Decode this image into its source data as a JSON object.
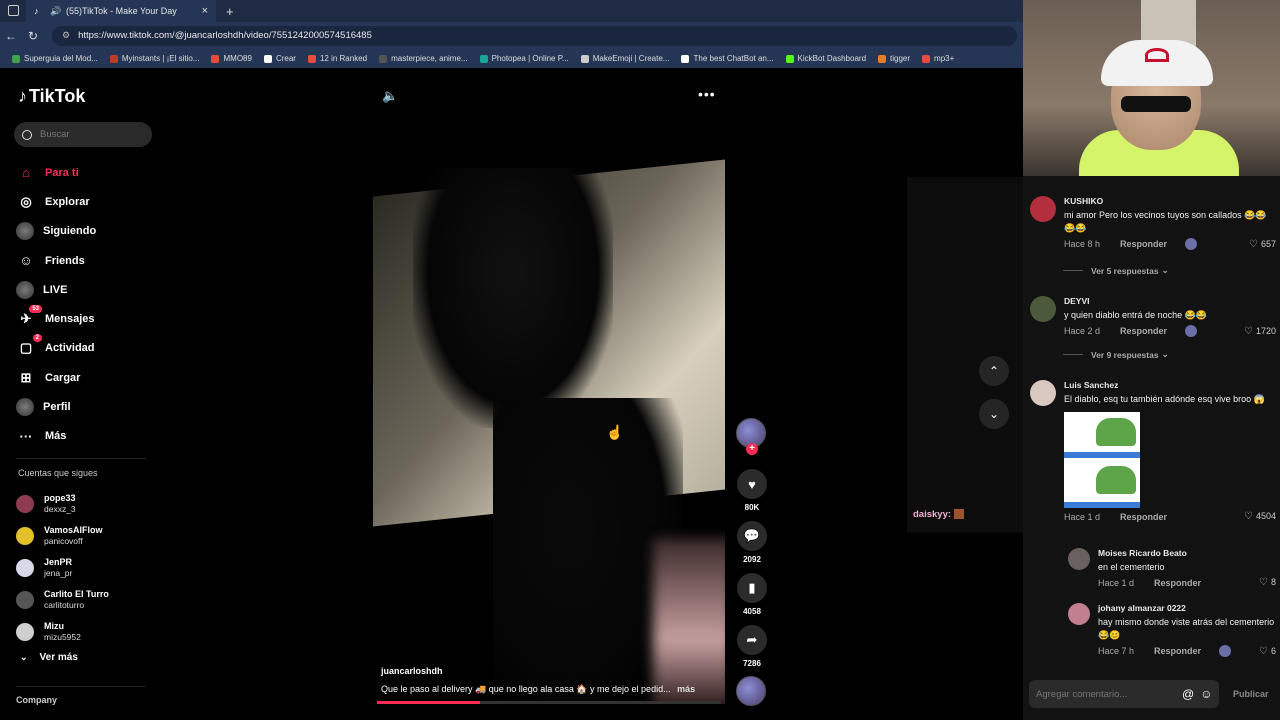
{
  "browser": {
    "tab_title": "(55)TikTok - Make Your Day",
    "url": "https://www.tiktok.com/@juancarloshdh/video/7551242000574516485",
    "bookmarks": [
      {
        "label": "Superguia del Mod...",
        "color": "#3fa34d"
      },
      {
        "label": "Myinstants | ¡El sitio...",
        "color": "#c0392b"
      },
      {
        "label": "MMO89",
        "color": "#e74c3c"
      },
      {
        "label": "Crear",
        "color": "#ffffff"
      },
      {
        "label": "12 in Ranked",
        "color": "#e74c3c"
      },
      {
        "label": "masterpiece, anime...",
        "color": "#555555"
      },
      {
        "label": "Photopea | Online P...",
        "color": "#18a497"
      },
      {
        "label": "MakeEmoji | Create...",
        "color": "#cccccc"
      },
      {
        "label": "The best ChatBot an...",
        "color": "#ffffff"
      },
      {
        "label": "KickBot Dashboard",
        "color": "#53fc18"
      },
      {
        "label": "tigger",
        "color": "#e67e22"
      },
      {
        "label": "mp3+",
        "color": "#e74c3c"
      }
    ]
  },
  "sidebar": {
    "logo": "TikTok",
    "search_placeholder": "Buscar",
    "nav": [
      {
        "label": "Para ti",
        "icon": "home-icon",
        "glyph": "⌂"
      },
      {
        "label": "Explorar",
        "icon": "compass-icon",
        "glyph": "◎"
      },
      {
        "label": "Siguiendo",
        "icon": "following-avatar",
        "glyph": "●"
      },
      {
        "label": "Friends",
        "icon": "friends-icon",
        "glyph": "☺"
      },
      {
        "label": "LIVE",
        "icon": "live-avatar",
        "glyph": "●"
      },
      {
        "label": "Mensajes",
        "icon": "messages-icon",
        "glyph": "✈",
        "badge": "53"
      },
      {
        "label": "Actividad",
        "icon": "activity-icon",
        "glyph": "▢",
        "badge": "2"
      },
      {
        "label": "Cargar",
        "icon": "upload-icon",
        "glyph": "⊞"
      },
      {
        "label": "Perfil",
        "icon": "profile-avatar",
        "glyph": "●"
      },
      {
        "label": "Más",
        "icon": "more-icon",
        "glyph": "···"
      }
    ],
    "following_title": "Cuentas que sigues",
    "following": [
      {
        "name": "pope33",
        "handle": "dexxz_3",
        "color": "#8e3b52"
      },
      {
        "name": "VamosAlFlow",
        "handle": "panicovoff",
        "color": "#e3c02a"
      },
      {
        "name": "JenPR",
        "handle": "jena_pr",
        "color": "#d8d8e8"
      },
      {
        "name": "Carlito El Turro",
        "handle": "carlitoturro",
        "color": "#555555"
      },
      {
        "name": "Mizu",
        "handle": "mizu5952",
        "color": "#cfcfcf"
      }
    ],
    "ver_mas": "Ver más",
    "company": "Company"
  },
  "video": {
    "author": "juancarloshdh",
    "caption": "Que le paso al delivery 🚚 que no llego ala casa 🏠 y me dejo el pedid...",
    "more": "más",
    "progress": 0.3,
    "likes": "80K",
    "comments": "2092",
    "saves": "4058",
    "shares": "7286"
  },
  "overlay": {
    "daisky": "daiskyy:"
  },
  "comments": [
    {
      "name": "KUSHIKO",
      "text": "mi amor Pero los vecinos tuyos son callados 😂😂😂😂",
      "time": "Hace 8 h",
      "reply": "Responder",
      "likes": "657",
      "avatar": "#b22e3c",
      "view_replies": "Ver 5 respuestas"
    },
    {
      "name": "DEYVI",
      "text": "y quien diablo entrá de noche 😂😂",
      "time": "Hace 2 d",
      "reply": "Responder",
      "likes": "1720",
      "avatar": "#4a5a3a",
      "view_replies": "Ver 9 respuestas"
    },
    {
      "name": "Luis Sanchez",
      "text": "El diablo, esq tu también adónde esq vive broo 😱",
      "time": "Hace 1 d",
      "reply": "Responder",
      "likes": "4504",
      "avatar": "#d8c8c0"
    },
    {
      "name": "Moises Ricardo Beato",
      "text": "en el cementerio",
      "time": "Hace 1 d",
      "reply": "Responder",
      "likes": "8",
      "avatar": "#6a6060"
    },
    {
      "name": "johany almanzar 0222",
      "text": "hay mismo donde viste atrás del cementerio 😂😊",
      "time": "Hace 7 h",
      "reply": "Responder",
      "likes": "6",
      "avatar": "#c08090"
    }
  ],
  "comment_input": {
    "placeholder": "Agregar comentario...",
    "publish": "Publicar"
  }
}
